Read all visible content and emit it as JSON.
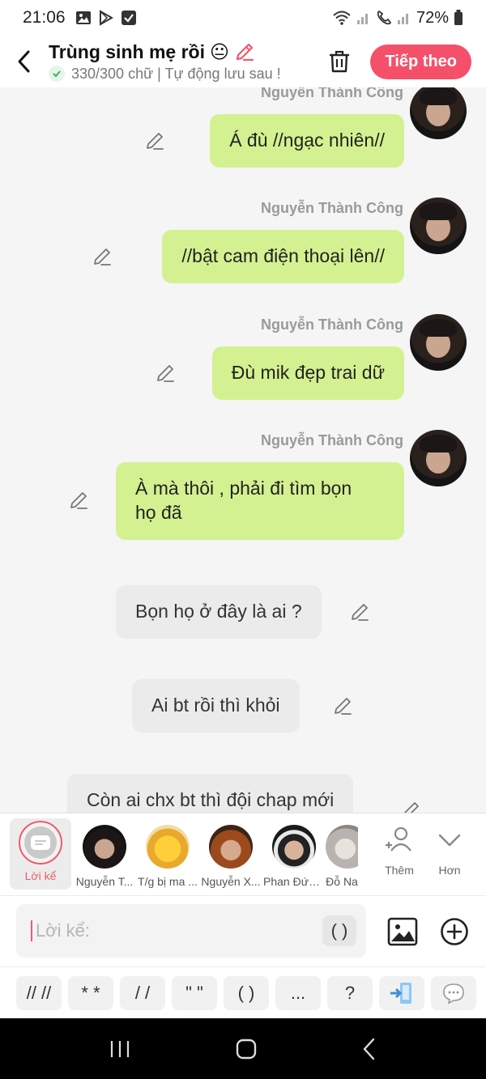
{
  "status_bar": {
    "time": "21:06",
    "battery": "72%",
    "left_icons": [
      "image-icon",
      "play-store-icon",
      "checkbox-icon"
    ],
    "right_icons": [
      "wifi-icon",
      "signal-icon",
      "call-icon",
      "signal-icon",
      "battery-icon"
    ]
  },
  "header": {
    "title": "Trùng sinh mẹ rồi",
    "title_emoji": "😐",
    "subtitle": "330/300 chữ | Tự động lưu sau !",
    "next_label": "Tiếp theo"
  },
  "messages": [
    {
      "type": "character",
      "sender": "Nguyễn Thành Công",
      "lines": [
        "Á đù //ngạc nhiên//"
      ]
    },
    {
      "type": "character",
      "sender": "Nguyễn Thành Công",
      "lines": [
        "//bật cam điện thoại lên//"
      ]
    },
    {
      "type": "character",
      "sender": "Nguyễn Thành Công",
      "lines": [
        "Đù mik đẹp trai dữ"
      ]
    },
    {
      "type": "character",
      "sender": "Nguyễn Thành Công",
      "lines": [
        "À mà thôi , phải đi tìm bọn",
        "họ đã"
      ]
    },
    {
      "type": "narration",
      "lines": [
        "Bọn họ ở đây là ai ?"
      ]
    },
    {
      "type": "narration",
      "lines": [
        "Ai bt rồi thì khỏi"
      ]
    },
    {
      "type": "narration",
      "lines": [
        "Còn ai chx bt thì đội chap mới"
      ]
    }
  ],
  "characters": [
    {
      "name": "Lời kể",
      "selected": true
    },
    {
      "name": "Nguyễn T..."
    },
    {
      "name": "T/g bị ma ..."
    },
    {
      "name": "Nguyễn X..."
    },
    {
      "name": "Phan Đức ..."
    },
    {
      "name": "Đỗ Na"
    }
  ],
  "char_actions": {
    "add_label": "Thêm",
    "more_label": "Hơn"
  },
  "input": {
    "placeholder": "Lời kể:",
    "paren_label": "( )"
  },
  "format_chips": [
    "// //",
    "* *",
    "/ /",
    "\" \"",
    "( )",
    "...",
    "?"
  ],
  "colors": {
    "accent": "#f5506a",
    "my_bubble": "#d4f191",
    "narration_bubble": "#ebebeb"
  }
}
